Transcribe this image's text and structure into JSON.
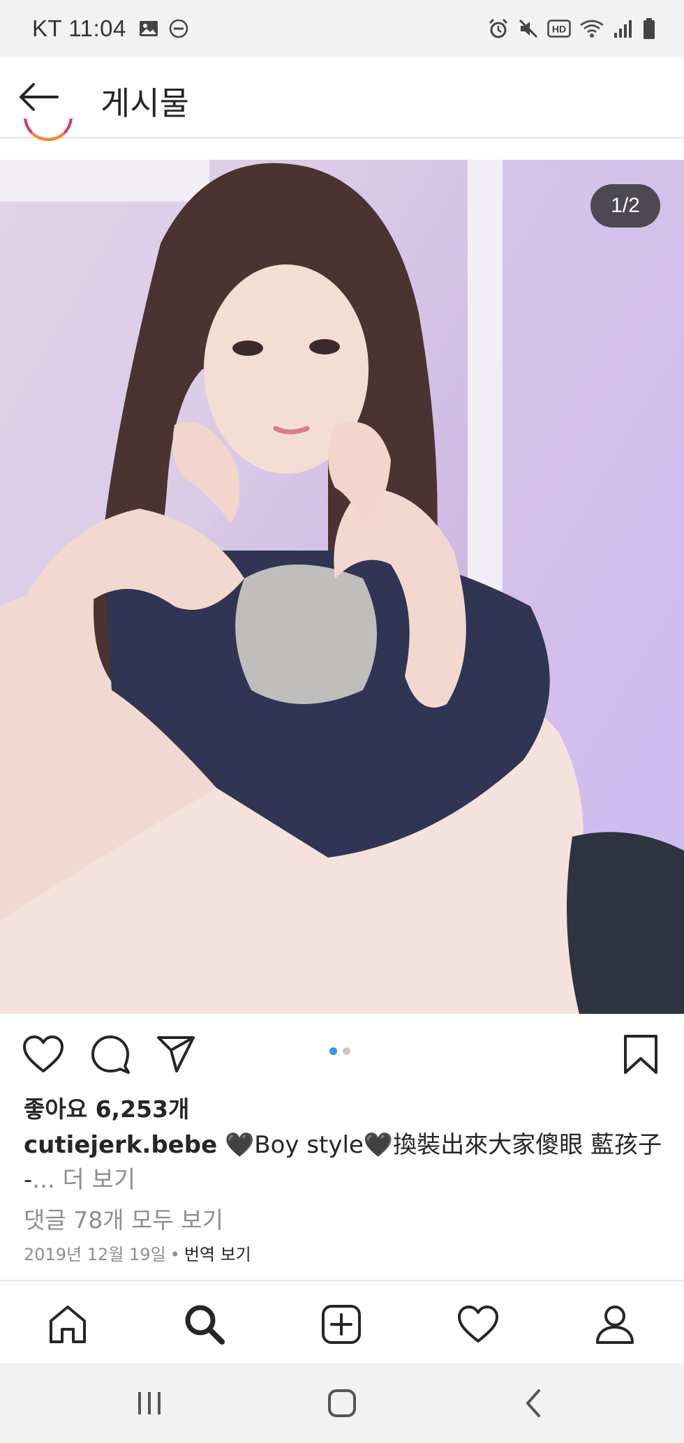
{
  "status_bar": {
    "carrier_time": "KT 11:04",
    "left_icons": [
      "gallery-icon",
      "do-not-disturb-icon"
    ],
    "right_icons": [
      "alarm-icon",
      "mute-icon",
      "hd-icon",
      "wifi-icon",
      "signal-icon",
      "battery-icon"
    ],
    "hd_label": "HD"
  },
  "header": {
    "title": "게시물",
    "back_icon": "back-arrow-icon"
  },
  "post": {
    "page_counter": "1/2",
    "image_count": 2,
    "current_image": 1,
    "likes": "좋아요 6,253개",
    "username": "cutiejerk.bebe",
    "caption_text": " 🖤Boy style🖤換裝出來大家傻眼 藍孩子",
    "caption_continuation": "-",
    "caption_more": "... 더 보기",
    "comments_link": "댓글 78개 모두 보기",
    "date": "2019년 12월 19일",
    "separator": "•",
    "translate": "번역 보기"
  },
  "actions": [
    "heart-icon",
    "comment-icon",
    "share-icon",
    "bookmark-icon"
  ],
  "bottom_nav": [
    "home-icon",
    "search-icon",
    "add-post-icon",
    "activity-icon",
    "profile-icon"
  ],
  "system_nav": [
    "recent-apps-icon",
    "home-button-icon",
    "system-back-icon"
  ],
  "colors": {
    "accent_blue": "#3897f0",
    "text": "#262626",
    "muted": "#8e8e8e",
    "status_bg": "#f2f2f2"
  }
}
